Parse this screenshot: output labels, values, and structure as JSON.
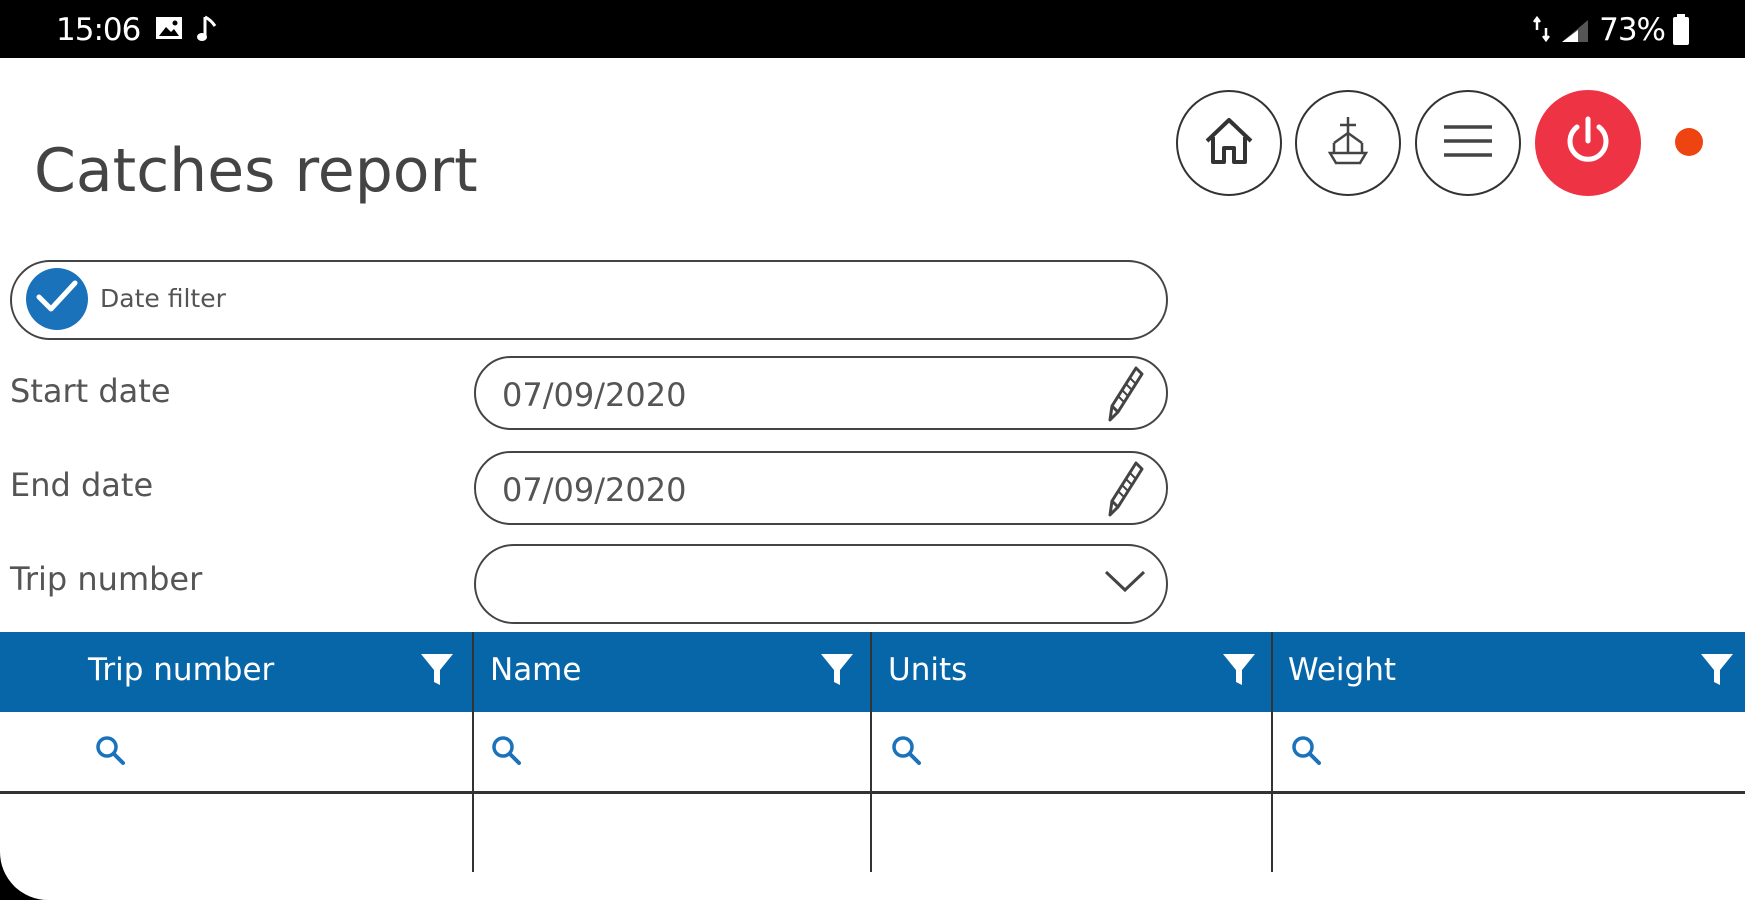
{
  "status_bar": {
    "time": "15:06",
    "battery_pct": "73%",
    "icons": [
      "image-icon",
      "music-note-icon",
      "data-arrows-icon",
      "signal-icon",
      "battery-icon"
    ]
  },
  "page": {
    "title": "Catches report"
  },
  "toolbar": {
    "buttons": [
      "home-icon",
      "vessel-icon",
      "menu-icon",
      "power-icon"
    ],
    "power_color": "#ee3344",
    "indicator_color": "#ee4411"
  },
  "filter": {
    "date_filter_label": "Date filter",
    "date_filter_checked": true,
    "start_date_label": "Start date",
    "start_date_value": "07/09/2020",
    "end_date_label": "End date",
    "end_date_value": "07/09/2020",
    "trip_number_label": "Trip number",
    "trip_number_value": ""
  },
  "grid": {
    "header_color": "#0766a8",
    "columns": [
      "Trip number",
      "Name",
      "Units",
      "Weight"
    ]
  }
}
